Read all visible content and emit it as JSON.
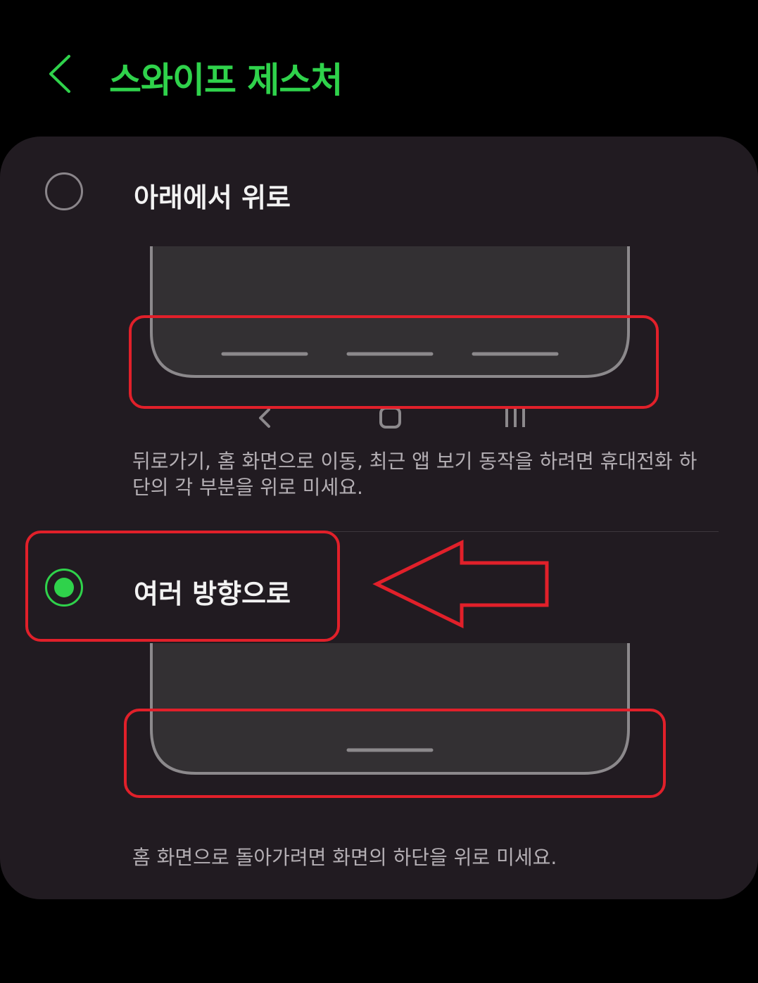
{
  "header": {
    "title": "스와이프 제스처"
  },
  "options": [
    {
      "label": "아래에서 위로",
      "selected": false,
      "description": "뒤로가기, 홈 화면으로 이동, 최근 앱 보기 동작을 하려면 휴대전화 하단의 각 부분을 위로 미세요."
    },
    {
      "label": "여러 방향으로",
      "selected": true,
      "description": "홈 화면으로 돌아가려면 화면의 하단을 위로 미세요."
    }
  ],
  "colors": {
    "accent": "#2fd24b",
    "card": "#211b21",
    "annotation": "#e1202a"
  }
}
